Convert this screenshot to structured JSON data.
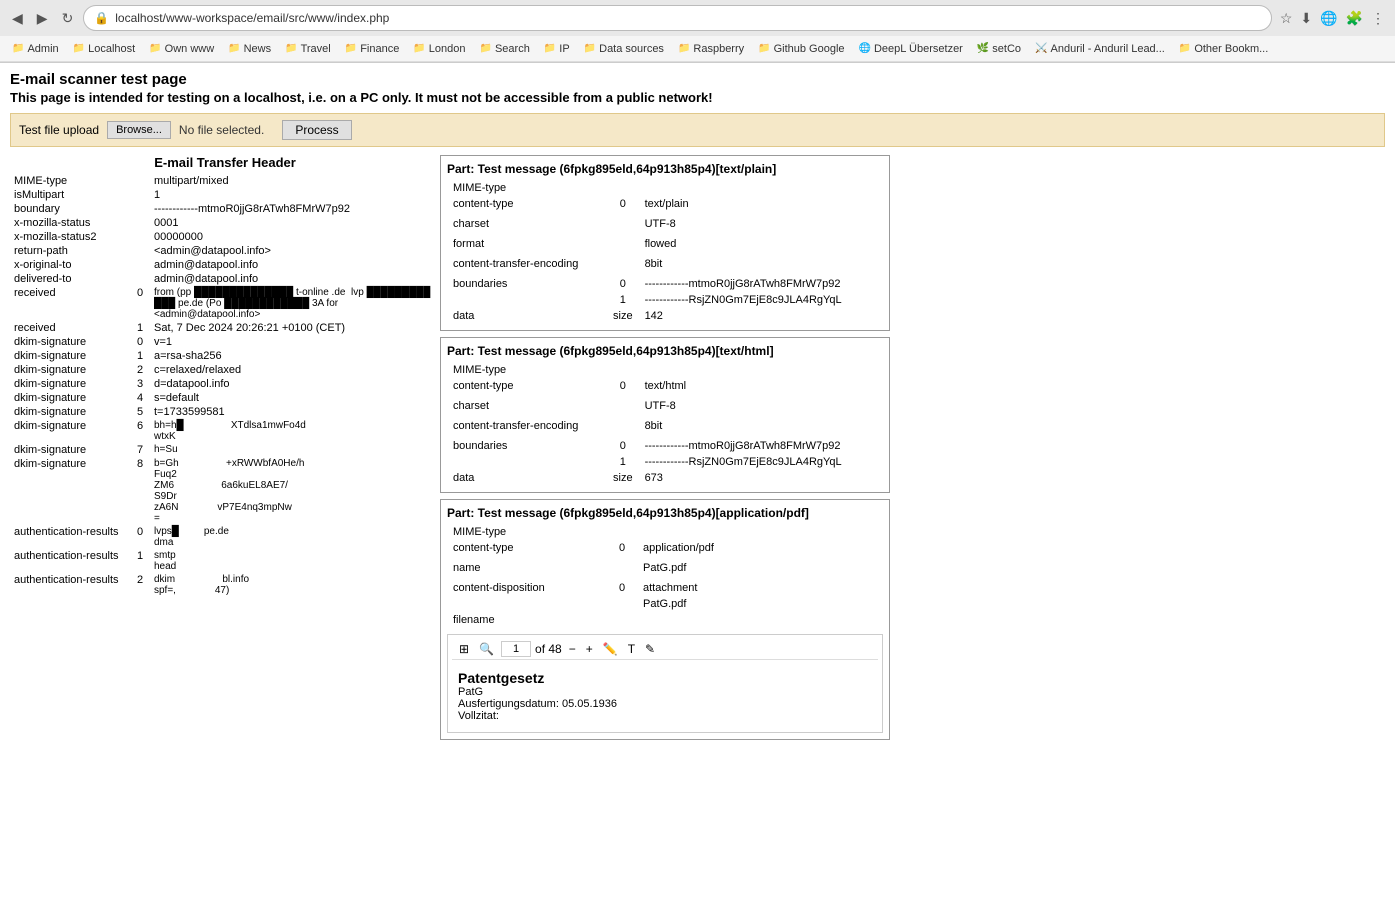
{
  "browser": {
    "url": "localhost/www-workspace/email/src/www/index.php",
    "nav": {
      "back": "◀",
      "forward": "▶",
      "reload": "↻"
    },
    "bookmarks": [
      {
        "label": "Admin",
        "icon": "📁"
      },
      {
        "label": "Localhost",
        "icon": "📁"
      },
      {
        "label": "Own www",
        "icon": "📁"
      },
      {
        "label": "News",
        "icon": "📁"
      },
      {
        "label": "Travel",
        "icon": "📁"
      },
      {
        "label": "Finance",
        "icon": "📁"
      },
      {
        "label": "London",
        "icon": "📁"
      },
      {
        "label": "Search",
        "icon": "📁"
      },
      {
        "label": "IP",
        "icon": "📁"
      },
      {
        "label": "Data sources",
        "icon": "📁"
      },
      {
        "label": "Raspberry",
        "icon": "📁"
      },
      {
        "label": "Github Google",
        "icon": "📁"
      },
      {
        "label": "DeepL Übersetzer",
        "icon": "🌐"
      },
      {
        "label": "setCo",
        "icon": "🌿"
      },
      {
        "label": "Anduril - Anduril Lead...",
        "icon": "⚔️"
      },
      {
        "label": "Other Bookm...",
        "icon": "📁"
      }
    ]
  },
  "page": {
    "title": "E-mail scanner test page",
    "subtitle": "This page is intended for testing on a localhost, i.e. on a PC only. It must not be accessible from a public network!"
  },
  "upload": {
    "label": "Test file upload",
    "browse": "Browse...",
    "no_file": "No file selected.",
    "process": "Process"
  },
  "email_header": {
    "title": "E-mail Transfer Header",
    "rows": [
      {
        "key": "MIME-type",
        "idx": "",
        "val": "multipart/mixed"
      },
      {
        "key": "isMultipart",
        "idx": "",
        "val": "1"
      },
      {
        "key": "boundary",
        "idx": "",
        "val": "------------mtmoR0jjG8rATwh8FMrW7p92"
      },
      {
        "key": "x-mozilla-status",
        "idx": "",
        "val": "0001"
      },
      {
        "key": "x-mozilla-status2",
        "idx": "",
        "val": "00000000"
      },
      {
        "key": "return-path",
        "idx": "",
        "val": "<admin@datapool.info>"
      },
      {
        "key": "x-original-to",
        "idx": "",
        "val": "admin@datapool.info"
      },
      {
        "key": "delivered-to",
        "idx": "",
        "val": "admin@datapool.info"
      },
      {
        "key": "received",
        "idx": "0",
        "val": "from (pp                    t-online .de  lvp                    pe.de (Po                    3A for <admin@datapool.info>"
      },
      {
        "key": "received",
        "idx": "1",
        "val": "Sat, 7 Dec 2024 20:26:21 +0100 (CET)"
      },
      {
        "key": "dkim-signature",
        "idx": "0",
        "val": "v=1"
      },
      {
        "key": "dkim-signature",
        "idx": "1",
        "val": "a=rsa-sha256"
      },
      {
        "key": "dkim-signature",
        "idx": "2",
        "val": "c=relaxed/relaxed"
      },
      {
        "key": "dkim-signature",
        "idx": "3",
        "val": "d=datapool.info"
      },
      {
        "key": "dkim-signature",
        "idx": "4",
        "val": "s=default"
      },
      {
        "key": "dkim-signature",
        "idx": "5",
        "val": "t=1733599581"
      },
      {
        "key": "dkim-signature",
        "idx": "6",
        "val": "bh=h                    wtxK                    XTdlsa1mwFo4d"
      },
      {
        "key": "dkim-signature",
        "idx": "7",
        "val": "h=Su                    b=Gh                    +xRWWbfA0He/h Fuq2                    ZM6                    6a6kuEL8AE7/ S9Dr                    zA6N                    vP7E4nq3mpNw ="
      },
      {
        "key": "dkim-signature",
        "idx": "8",
        "val": "b=Gh                    +xRWWbfA0He/h Fuq2                    ZM6                    6a6kuEL8AE7/ S9Dr                    zA6N                    vP7E4nq3mpNw ="
      },
      {
        "key": "authentication-results",
        "idx": "0",
        "val": "lvps                    pe.de dma"
      },
      {
        "key": "authentication-results",
        "idx": "1",
        "val": "smtp                    head"
      },
      {
        "key": "authentication-results",
        "idx": "2",
        "val": "dkim                    bl.info spf=,                    47)"
      }
    ]
  },
  "part_text_plain": {
    "title": "Part: Test message (6fpkg895eld,64p913h85p4)[text/plain]",
    "rows": [
      {
        "key": "MIME-type",
        "idx": "",
        "val": ""
      },
      {
        "key": "content-type",
        "idx": "0",
        "val": "text/plain"
      },
      {
        "key": "",
        "idx": "",
        "val": ""
      },
      {
        "key": "",
        "idx": "",
        "val": ""
      },
      {
        "key": "",
        "idx": "",
        "val": ""
      },
      {
        "key": "",
        "idx": "",
        "val": ""
      },
      {
        "key": "charset",
        "idx": "",
        "val": "UTF-8"
      },
      {
        "key": "",
        "idx": "",
        "val": ""
      },
      {
        "key": "format",
        "idx": "",
        "val": "flowed"
      },
      {
        "key": "",
        "idx": "",
        "val": ""
      },
      {
        "key": "content-transfer-encoding",
        "idx": "",
        "val": "8bit"
      },
      {
        "key": "",
        "idx": "",
        "val": ""
      },
      {
        "key": "boundaries",
        "idx": "0",
        "val": "------------mtmoR0jjG8rATwh8FMrW7p92"
      },
      {
        "key": "",
        "idx": "1",
        "val": "------------RsjZN0Gm7EjE8c9JLA4RgYqL"
      },
      {
        "key": "data",
        "idx": "size",
        "val": "142"
      }
    ]
  },
  "part_text_html": {
    "title": "Part: Test message (6fpkg895eld,64p913h85p4)[text/html]",
    "rows": [
      {
        "key": "MIME-type",
        "idx": "",
        "val": ""
      },
      {
        "key": "content-type",
        "idx": "0",
        "val": "text/html"
      },
      {
        "key": "",
        "idx": "",
        "val": ""
      },
      {
        "key": "charset",
        "idx": "",
        "val": "UTF-8"
      },
      {
        "key": "",
        "idx": "",
        "val": ""
      },
      {
        "key": "",
        "idx": "",
        "val": ""
      },
      {
        "key": "content-transfer-encoding",
        "idx": "",
        "val": "8bit"
      },
      {
        "key": "",
        "idx": "",
        "val": ""
      },
      {
        "key": "boundaries",
        "idx": "0",
        "val": "------------mtmoR0jjG8rATwh8FMrW7p92"
      },
      {
        "key": "",
        "idx": "1",
        "val": "------------RsjZN0Gm7EjE8c9JLA4RgYqL"
      },
      {
        "key": "data",
        "idx": "size",
        "val": "673"
      }
    ]
  },
  "part_pdf": {
    "title": "Part: Test message (6fpkg895eld,64p913h85p4)[application/pdf]",
    "rows": [
      {
        "key": "MIME-type",
        "idx": "",
        "val": ""
      },
      {
        "key": "content-type",
        "idx": "0",
        "val": "application/pdf"
      },
      {
        "key": "",
        "idx": "",
        "val": ""
      },
      {
        "key": "name",
        "idx": "",
        "val": "PatG.pdf"
      },
      {
        "key": "",
        "idx": "",
        "val": ""
      },
      {
        "key": "content-disposition",
        "idx": "0",
        "val": "attachment"
      },
      {
        "key": "",
        "idx": "",
        "val": ""
      },
      {
        "key": "",
        "idx": "",
        "val": "PatG.pdf"
      },
      {
        "key": "filename",
        "idx": "",
        "val": ""
      }
    ],
    "pdf_preview": {
      "page": "1",
      "total_pages": "48",
      "doc_title": "Patentgesetz",
      "doc_subtitle": "PatG",
      "field1_label": "Ausfertigungsdatum: 05.05.1936",
      "field2_label": "Vollzitat:"
    }
  }
}
